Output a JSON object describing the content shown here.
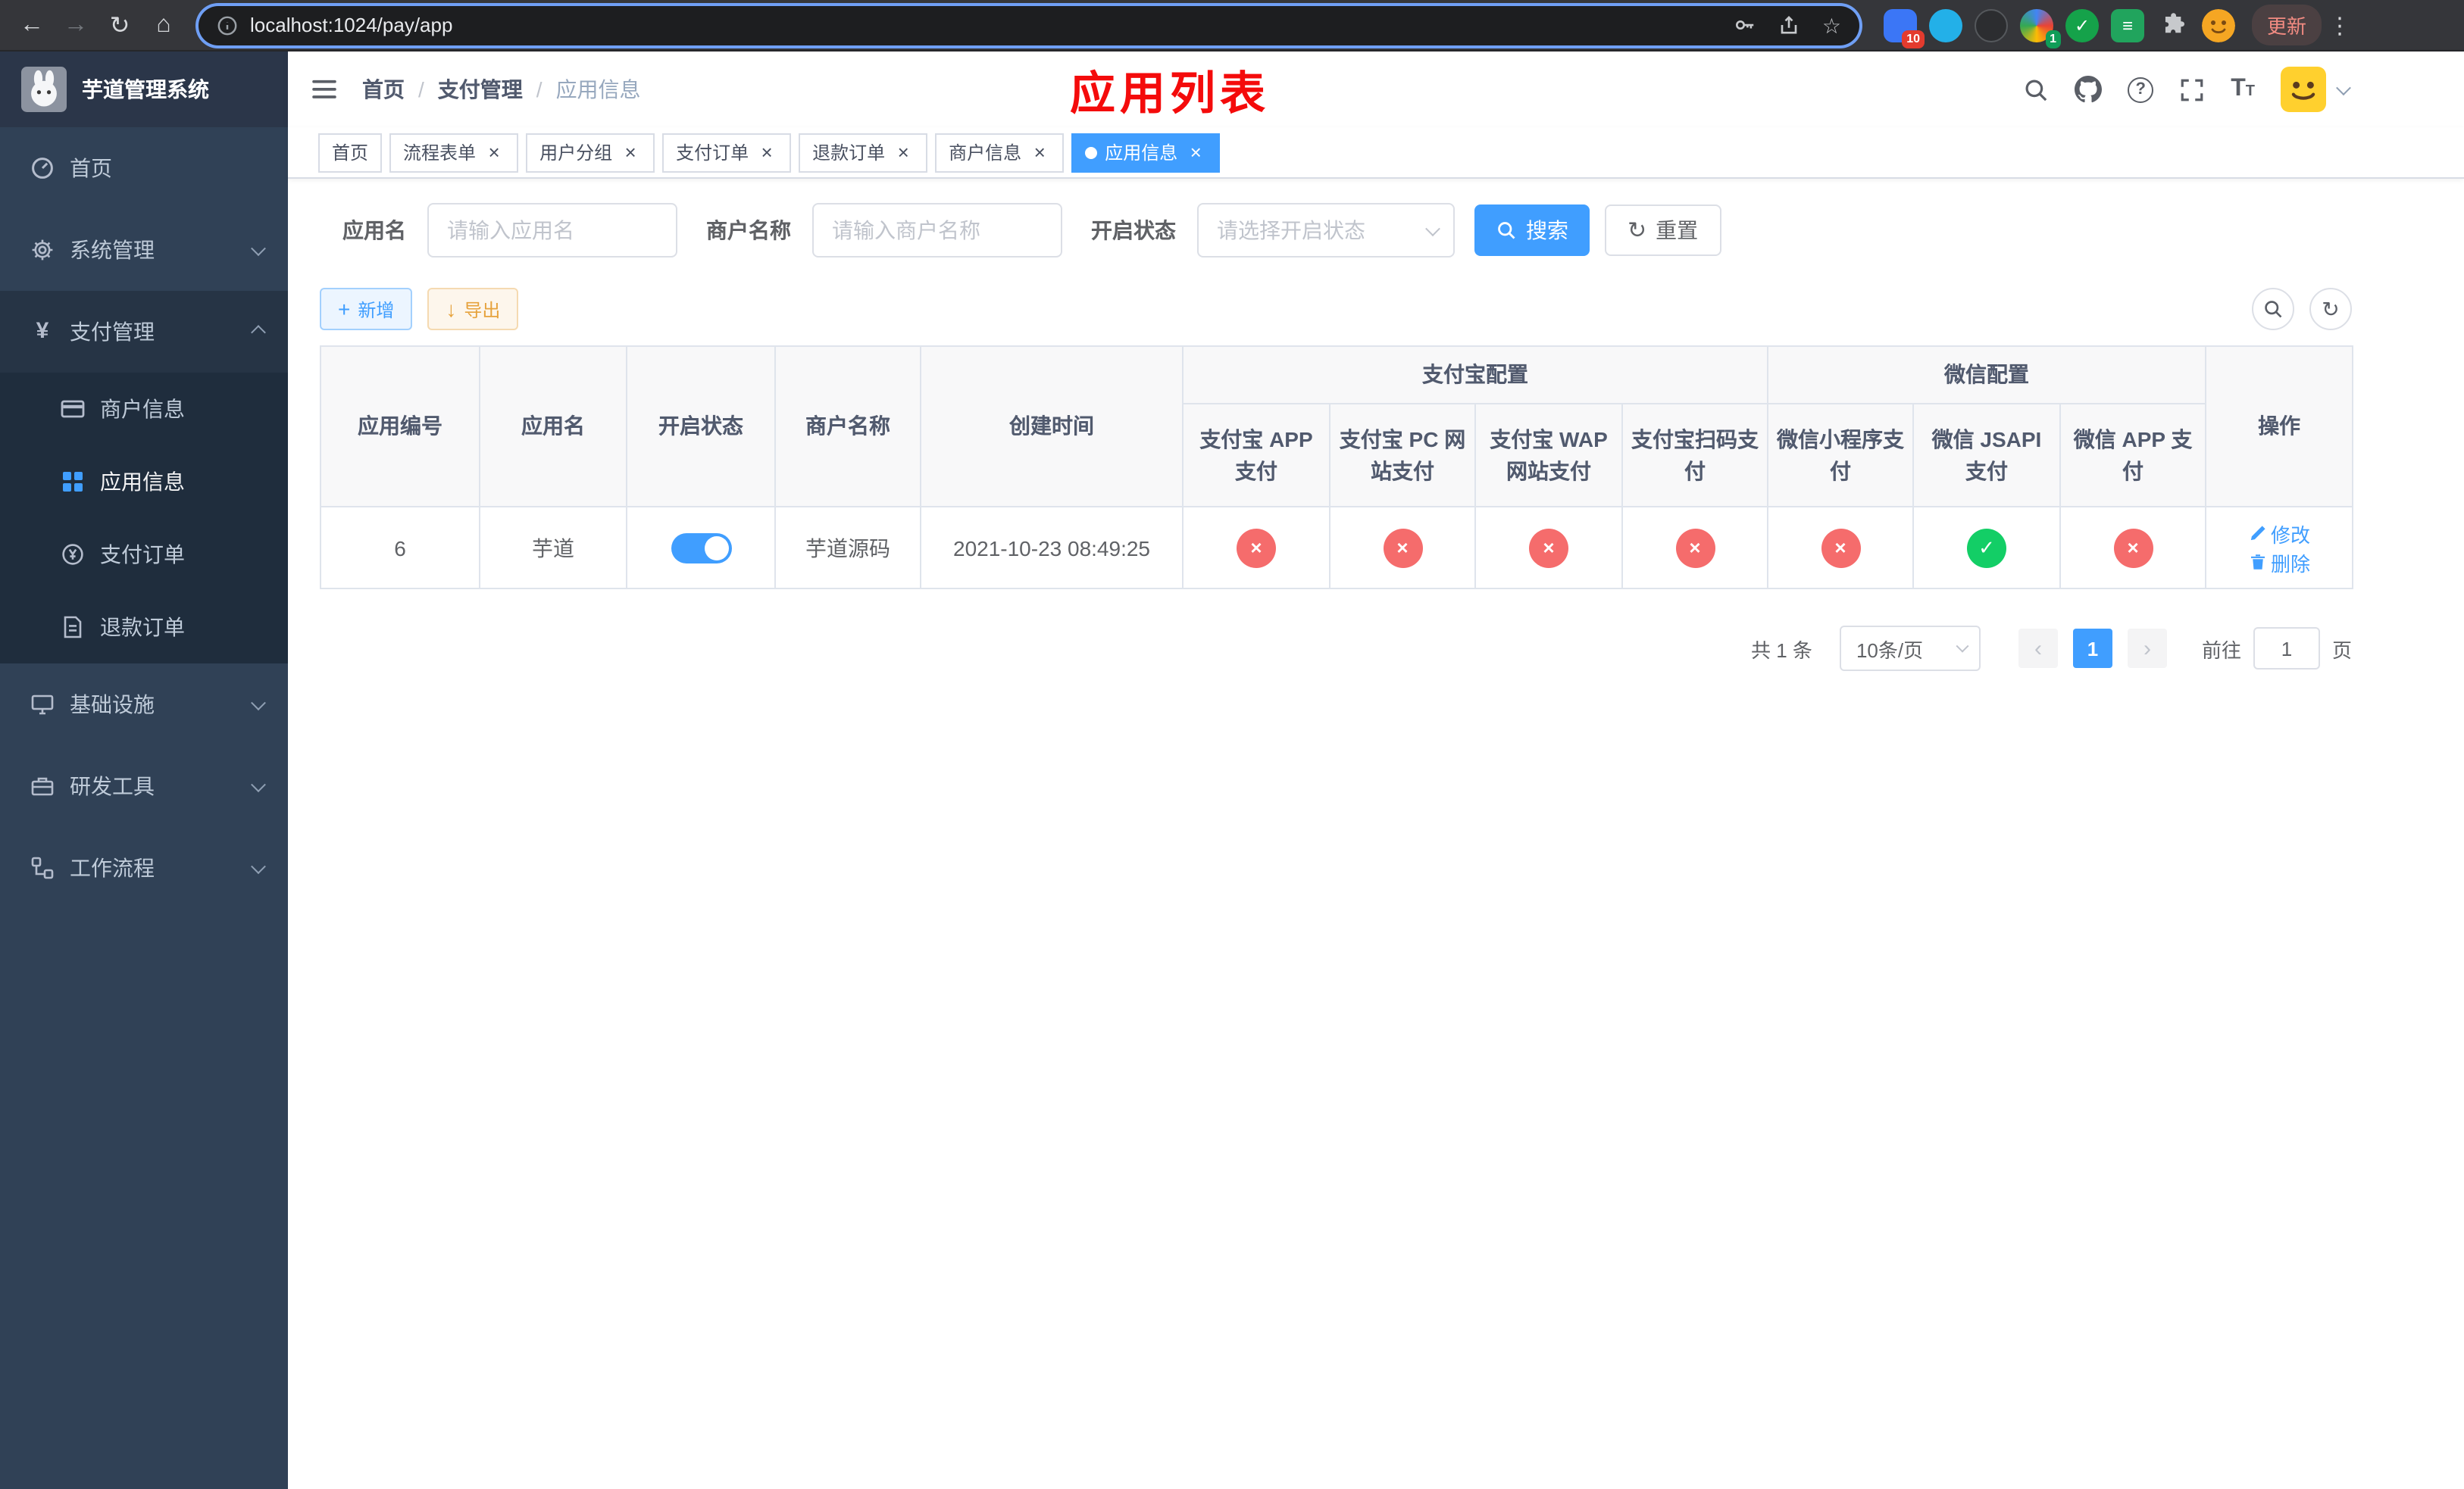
{
  "browser": {
    "url": "localhost:1024/pay/app",
    "update_label": "更新",
    "ext_badge_blue": "10",
    "ext_badge_colorful": "1"
  },
  "app": {
    "logo_title": "芋道管理系统"
  },
  "sidebar": {
    "items": [
      {
        "label": "首页"
      },
      {
        "label": "系统管理"
      },
      {
        "label": "支付管理"
      },
      {
        "label": "基础设施"
      },
      {
        "label": "研发工具"
      },
      {
        "label": "工作流程"
      }
    ],
    "submenu": [
      {
        "label": "商户信息"
      },
      {
        "label": "应用信息"
      },
      {
        "label": "支付订单"
      },
      {
        "label": "退款订单"
      }
    ]
  },
  "header": {
    "breadcrumb": {
      "home": "首页",
      "parent": "支付管理",
      "current": "应用信息"
    },
    "annotation": "应用列表"
  },
  "tabs": [
    {
      "label": "首页"
    },
    {
      "label": "流程表单"
    },
    {
      "label": "用户分组"
    },
    {
      "label": "支付订单"
    },
    {
      "label": "退款订单"
    },
    {
      "label": "商户信息"
    },
    {
      "label": "应用信息"
    }
  ],
  "filters": {
    "app_name": {
      "label": "应用名",
      "placeholder": "请输入应用名",
      "value": ""
    },
    "merchant_name": {
      "label": "商户名称",
      "placeholder": "请输入商户名称",
      "value": ""
    },
    "status": {
      "label": "开启状态",
      "placeholder": "请选择开启状态"
    },
    "search": "搜索",
    "reset": "重置"
  },
  "actions": {
    "add": "新增",
    "export": "导出"
  },
  "table": {
    "headers": {
      "id": "应用编号",
      "name": "应用名",
      "status": "开启状态",
      "merchant": "商户名称",
      "created": "创建时间",
      "alipay_group": "支付宝配置",
      "wechat_group": "微信配置",
      "alipay_app": "支付宝 APP 支付",
      "alipay_pc": "支付宝 PC 网站支付",
      "alipay_wap": "支付宝 WAP 网站支付",
      "alipay_qr": "支付宝扫码支付",
      "wx_mini": "微信小程序支付",
      "wx_jsapi": "微信 JSAPI 支付",
      "wx_app": "微信 APP 支付",
      "actions": "操作"
    },
    "row": {
      "id": "6",
      "name": "芋道",
      "enabled": true,
      "merchant": "芋道源码",
      "created": "2021-10-23 08:49:25",
      "pay": {
        "alipay_app": false,
        "alipay_pc": false,
        "alipay_wap": false,
        "alipay_qr": false,
        "wx_mini": false,
        "wx_jsapi": true,
        "wx_app": false
      },
      "edit": "修改",
      "delete": "删除"
    }
  },
  "pagination": {
    "total": "共 1 条",
    "size": "10条/页",
    "page": "1",
    "goto_label": "前往",
    "goto_value": "1",
    "goto_unit": "页"
  },
  "colors": {
    "primary": "#409eff",
    "danger": "#f56c6c",
    "success": "#13ce66",
    "warning": "#e6a23c",
    "sidebar_bg": "#304156",
    "annotation_red": "#f40b0b"
  }
}
